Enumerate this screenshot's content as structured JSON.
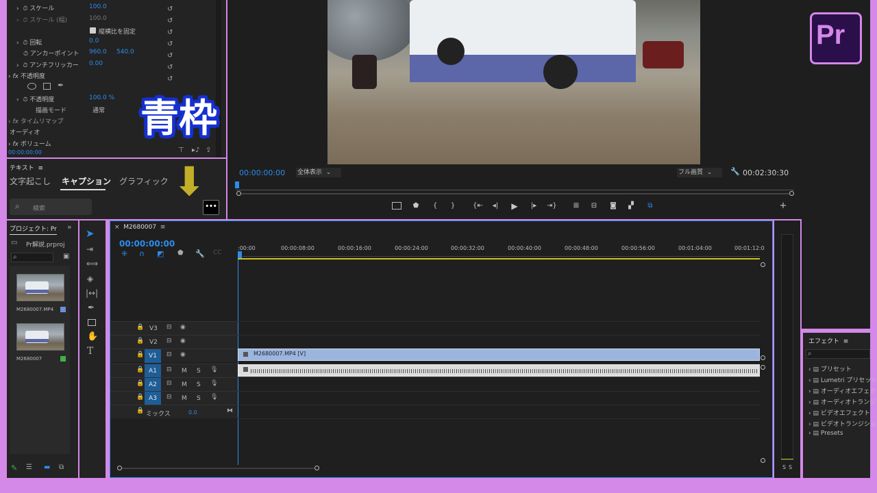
{
  "logo": {
    "text": "Pr"
  },
  "overlay": {
    "caption": "青枠",
    "arrow": "⬇"
  },
  "effect_controls": {
    "rows": [
      {
        "label": "スケール",
        "value": "100.0"
      },
      {
        "label": "スケール (幅)",
        "value": "100.0"
      },
      {
        "label": "縦横比を固定",
        "checked": true
      },
      {
        "label": "回転",
        "value": "0.0"
      },
      {
        "label": "アンカーポイント",
        "value": "960.0",
        "value2": "540.0"
      },
      {
        "label": "アンチフリッカー",
        "value": "0.00"
      },
      {
        "label": "不透明度"
      },
      {
        "label": "不透明度",
        "value": "100.0 %"
      },
      {
        "label": "描画モード",
        "value": "通常"
      },
      {
        "label": "タイムリマップ"
      },
      {
        "label": "オーディオ"
      },
      {
        "label": "ボリューム"
      }
    ],
    "timecode": "00:00:00:00"
  },
  "text_panel": {
    "title": "テキスト",
    "tabs": [
      "文字起こし",
      "キャプション",
      "グラフィック"
    ],
    "active_tab": 1,
    "search_placeholder": "検索"
  },
  "program_monitor": {
    "timecode": "00:00:00:00",
    "zoom": "全体表示",
    "quality": "フル画質",
    "duration": "00:02:30:30"
  },
  "project": {
    "title": "プロジェクト: Pr",
    "file": "Pr解説.prproj",
    "items": [
      {
        "name": "M2680007.MP4",
        "color": "#6f8fd6"
      },
      {
        "name": "M2680007",
        "color": "#3fb04d"
      }
    ]
  },
  "timeline": {
    "tab": "M2680007",
    "timecode": "00:00:00:00",
    "ruler": [
      ":00:00",
      "00:00:08:00",
      "00:00:16:00",
      "00:00:24:00",
      "00:00:32:00",
      "00:00:40:00",
      "00:00:48:00",
      "00:00:56:00",
      "00:01:04:00",
      "00:01:12:0"
    ],
    "video_tracks": [
      "V3",
      "V2",
      "V1"
    ],
    "audio_tracks": [
      "A1",
      "A2",
      "A3"
    ],
    "mix_label": "ミックス",
    "mix_value": "0.0",
    "clip_label": "M2680007.MP4 [V]",
    "m": "M",
    "s": "S"
  },
  "effects": {
    "title": "エフェクト",
    "items": [
      "プリセット",
      "Lumetri プリセット",
      "オーディオエフェクト",
      "オーディオトランジション",
      "ビデオエフェクト",
      "ビデオトランジション",
      "Presets"
    ]
  },
  "meter": {
    "s1": "S",
    "s2": "S"
  }
}
